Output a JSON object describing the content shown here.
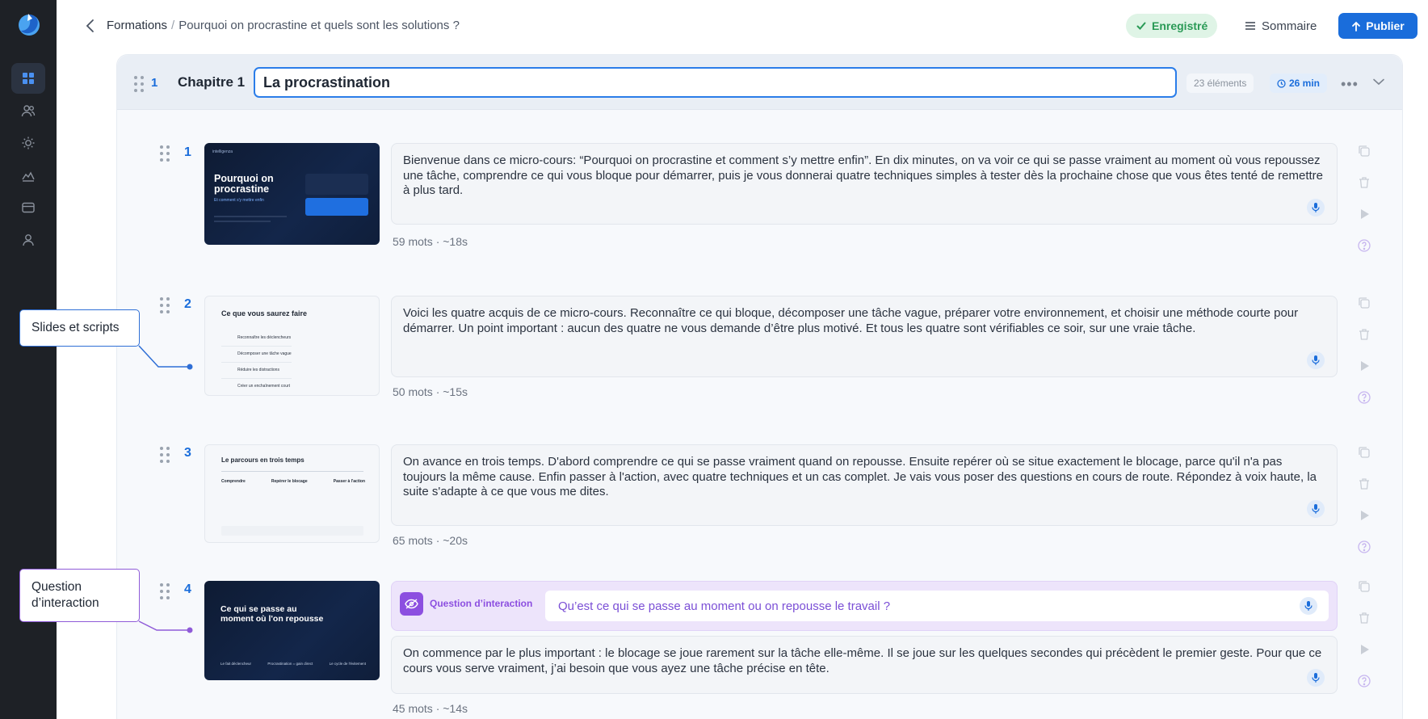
{
  "sidebar": {
    "icons": [
      "dashboard-icon",
      "users-icon",
      "sun-icon",
      "chart-icon",
      "card-icon",
      "user-icon"
    ]
  },
  "header": {
    "breadcrumb_root": "Formations",
    "breadcrumb_separator": "/",
    "breadcrumb_current": "Pourquoi on procrastine et quels sont les solutions ?",
    "saved_label": "Enregistré",
    "summary_label": "Sommaire",
    "publish_label": "Publier"
  },
  "chapter": {
    "number": "1",
    "label": "Chapitre 1",
    "title": "La procrastination",
    "elements_count": "23 éléments",
    "duration": "26 min"
  },
  "slides": [
    {
      "number": "1",
      "thumb": {
        "header": "intelligenza",
        "title": "Pourquoi on procrastine",
        "subtitle": "Et comment s'y mettre enfin"
      },
      "script": "Bienvenue dans ce micro-cours: “Pourquoi on procrastine et comment s’y mettre enfin”. En dix minutes, on va voir ce qui se passe vraiment au moment où vous repoussez une tâche, comprendre ce qui vous bloque pour démarrer, puis je vous donnerai quatre techniques simples à tester dès la prochaine chose que vous êtes tenté de remettre à plus tard.",
      "stats": "59 mots · ~18s"
    },
    {
      "number": "2",
      "thumb": {
        "title": "Ce que vous saurez faire",
        "items": [
          "Reconnaître les déclencheurs",
          "Décomposer une tâche vague",
          "Réduire les distractions",
          "Créer un enchaînement court"
        ]
      },
      "script": "Voici les quatre acquis de ce micro-cours. Reconnaître ce qui bloque, décomposer une tâche vague, préparer votre environnement, et choisir une méthode courte pour démarrer. Un point important : aucun des quatre ne vous demande d’être plus motivé. Et tous les quatre sont vérifiables ce soir, sur une vraie tâche.",
      "stats": "50 mots · ~15s"
    },
    {
      "number": "3",
      "thumb": {
        "title": "Le parcours en trois temps",
        "columns": [
          "Comprendre",
          "Repérer le blocage",
          "Passer à l'action"
        ]
      },
      "script": "On avance en trois temps. D'abord comprendre ce qui se passe vraiment quand on repousse. Ensuite repérer où se situe exactement le blocage, parce qu'il n'a pas toujours la même cause. Enfin passer à l'action, avec quatre techniques et un cas complet. Je vais vous poser des questions en cours de route. Répondez à voix haute, la suite s'adapte à ce que vous me dites.",
      "stats": "65 mots · ~20s"
    },
    {
      "number": "4",
      "thumb": {
        "title": "Ce qui se passe au moment où l'on repousse",
        "footer": [
          "Le fait déclencheur",
          "Procrastination = gain direct",
          "Le cycle de l'évitement"
        ]
      },
      "question_label": "Question d’interaction",
      "question": "Qu’est ce qui se passe au moment ou on repousse le travail ?",
      "script": "On commence par le plus important : le blocage se joue rarement sur la tâche elle-même. Il se joue sur les quelques secondes qui précèdent le premier geste. Pour que ce cours vous serve vraiment, j’ai besoin que vous ayez une tâche précise en tête.",
      "stats": "45 mots · ~14s"
    }
  ],
  "callouts": {
    "slides_scripts": "Slides et scripts",
    "question_line1": "Question",
    "question_line2": "d’interaction"
  },
  "colors": {
    "accent": "#1a6ddb",
    "saved_bg": "#dff4e6",
    "saved_text": "#2a9a56",
    "question_accent": "#8c4fe0",
    "sidebar_bg": "#1e2126"
  }
}
